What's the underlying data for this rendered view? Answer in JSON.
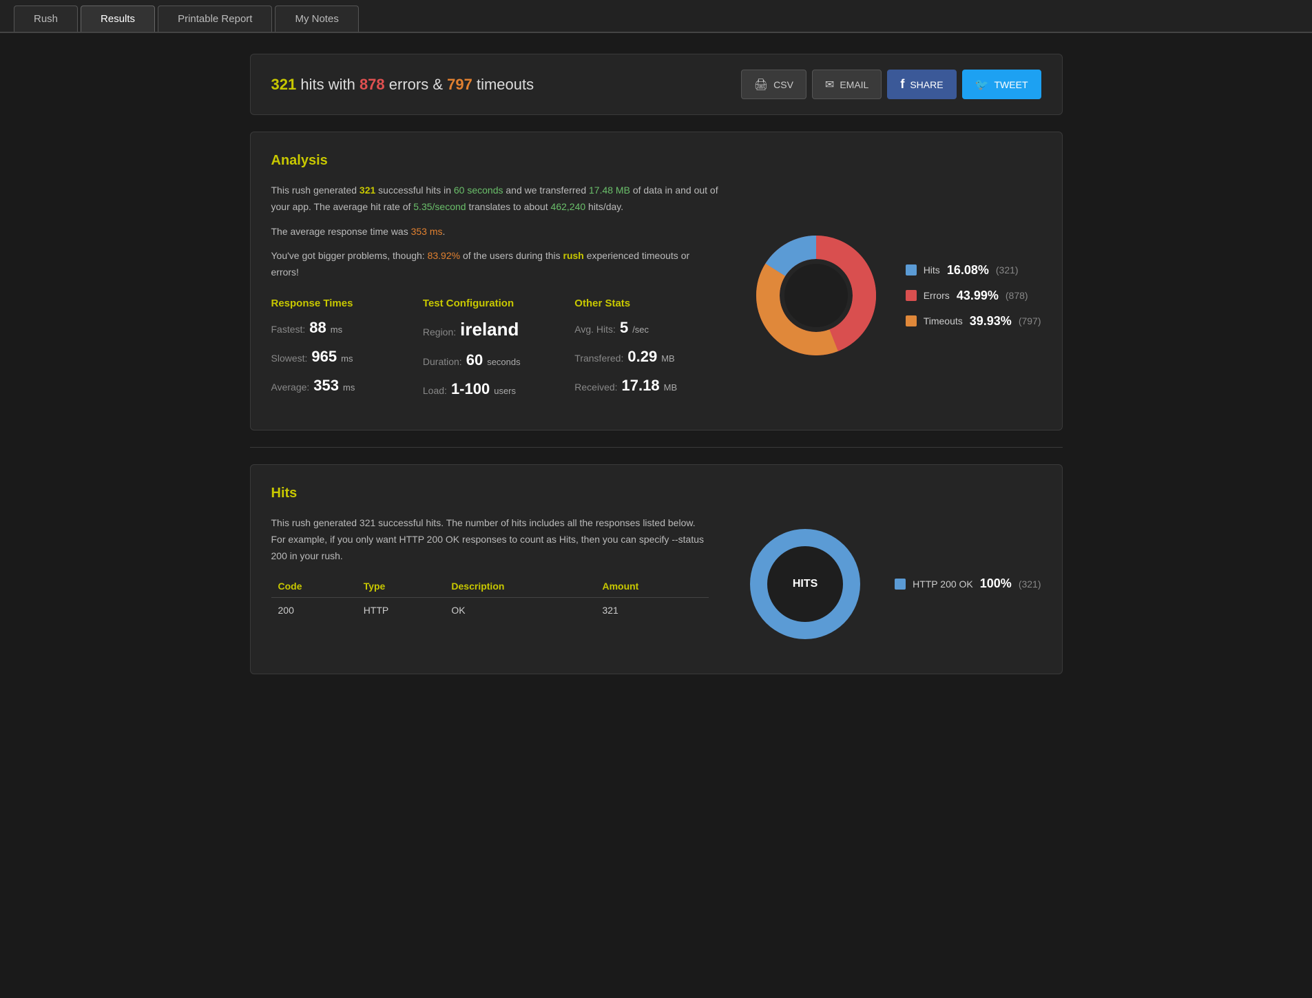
{
  "tabs": [
    {
      "id": "rush",
      "label": "Rush"
    },
    {
      "id": "results",
      "label": "Results",
      "active": true
    },
    {
      "id": "printable",
      "label": "Printable Report"
    },
    {
      "id": "mynotes",
      "label": "My Notes"
    }
  ],
  "summary": {
    "hits": "321",
    "errors": "878",
    "timeouts": "797",
    "text_prefix": "",
    "text_hits_label": "hits with",
    "text_errors_label": "errors &",
    "text_timeouts_label": "timeouts"
  },
  "action_buttons": [
    {
      "id": "csv",
      "label": "CSV",
      "icon": "🖨"
    },
    {
      "id": "email",
      "label": "EMAIL",
      "icon": "✉"
    },
    {
      "id": "share",
      "label": "SHARE",
      "icon": "f",
      "type": "facebook"
    },
    {
      "id": "tweet",
      "label": "TWEET",
      "icon": "t",
      "type": "twitter"
    }
  ],
  "analysis": {
    "title": "Analysis",
    "para1_prefix": "This rush generated ",
    "para1_hits": "321",
    "para1_mid1": " successful hits in ",
    "para1_seconds": "60 seconds",
    "para1_mid2": " and we transferred ",
    "para1_mb": "17.48 MB",
    "para1_mid3": " of data in and out of your app. The average hit rate of ",
    "para1_rate": "5.35/second",
    "para1_mid4": " translates to about ",
    "para1_hitsday": "462,240",
    "para1_suffix": " hits/day.",
    "para2_prefix": "The average response time was ",
    "para2_ms": "353 ms",
    "para2_suffix": ".",
    "para3_prefix": "You've got bigger problems, though: ",
    "para3_pct": "83.92%",
    "para3_mid": " of the users during this ",
    "para3_rush": "rush",
    "para3_suffix": " experienced timeouts or errors!",
    "chart": {
      "hits_pct": 16.08,
      "errors_pct": 43.99,
      "timeouts_pct": 39.93,
      "hits_count": "321",
      "errors_count": "878",
      "timeouts_count": "797",
      "hits_label": "Hits",
      "errors_label": "Errors",
      "timeouts_label": "Timeouts",
      "hits_color": "#5b9bd5",
      "errors_color": "#d94f4f",
      "timeouts_color": "#e0883a"
    }
  },
  "response_times": {
    "title": "Response Times",
    "fastest_label": "Fastest:",
    "fastest_val": "88",
    "fastest_unit": "ms",
    "slowest_label": "Slowest:",
    "slowest_val": "965",
    "slowest_unit": "ms",
    "average_label": "Average:",
    "average_val": "353",
    "average_unit": "ms"
  },
  "test_config": {
    "title": "Test Configuration",
    "region_label": "Region:",
    "region_val": "ireland",
    "duration_label": "Duration:",
    "duration_val": "60",
    "duration_unit": "seconds",
    "load_label": "Load:",
    "load_val": "1-100",
    "load_unit": "users"
  },
  "other_stats": {
    "title": "Other Stats",
    "avghits_label": "Avg. Hits:",
    "avghits_val": "5",
    "avghits_unit": "/sec",
    "transferred_label": "Transfered:",
    "transferred_val": "0.29",
    "transferred_unit": "MB",
    "received_label": "Received:",
    "received_val": "17.18",
    "received_unit": "MB"
  },
  "hits_section": {
    "title": "Hits",
    "para1_prefix": "This rush generated ",
    "para1_count": "321",
    "para1_mid": " successful hits. The number of hits includes all the responses listed below. For example, if you only want ",
    "para1_link": "HTTP 200 OK",
    "para1_mid2": " responses to count as Hits, then you can specify ",
    "para1_flag": "--status 200",
    "para1_suffix": " in your rush.",
    "table": {
      "columns": [
        "Code",
        "Type",
        "Description",
        "Amount"
      ],
      "rows": [
        {
          "code": "200",
          "type": "HTTP",
          "description": "OK",
          "amount": "321"
        }
      ]
    },
    "chart": {
      "color": "#5b9bd5",
      "label": "HITS",
      "legend_label": "HTTP 200 OK",
      "legend_pct": "100%",
      "legend_count": "321"
    }
  }
}
